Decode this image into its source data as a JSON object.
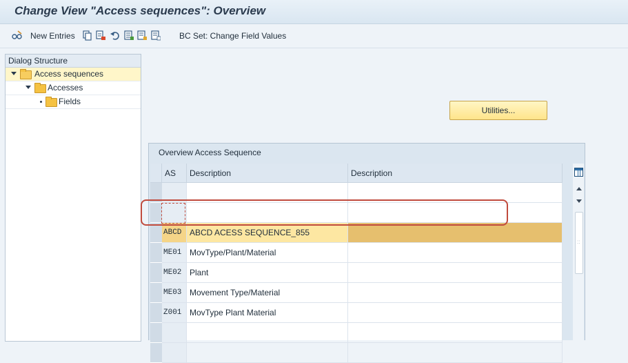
{
  "window": {
    "title": "Change View \"Access sequences\": Overview"
  },
  "toolbar": {
    "new_entries": "New Entries",
    "bc_set": "BC Set: Change Field Values"
  },
  "dialog_structure": {
    "header": "Dialog Structure",
    "items": [
      {
        "label": "Access sequences",
        "selected": true
      },
      {
        "label": "Accesses",
        "selected": false
      },
      {
        "label": "Fields",
        "selected": false
      }
    ]
  },
  "utilities_button": "Utilities...",
  "table": {
    "title": "Overview Access Sequence",
    "columns": [
      "AS",
      "Description",
      "Description"
    ],
    "rows": [
      {
        "code": "",
        "desc": "",
        "desc2": ""
      },
      {
        "code": "",
        "desc": "",
        "desc2": ""
      },
      {
        "code": "ABCD",
        "desc": "ABCD ACESS SEQUENCE_855",
        "desc2": "",
        "highlighted": true
      },
      {
        "code": "ME01",
        "desc": "MovType/Plant/Material",
        "desc2": ""
      },
      {
        "code": "ME02",
        "desc": "Plant",
        "desc2": ""
      },
      {
        "code": "ME03",
        "desc": "Movement Type/Material",
        "desc2": ""
      },
      {
        "code": "Z001",
        "desc": "MovType Plant Material",
        "desc2": ""
      },
      {
        "code": "",
        "desc": "",
        "desc2": ""
      },
      {
        "code": "",
        "desc": "",
        "desc2": ""
      }
    ]
  },
  "colors": {
    "highlight_row": "#fde7a2",
    "annotation": "#c04a3c",
    "primary_button": "#ffe48a"
  }
}
